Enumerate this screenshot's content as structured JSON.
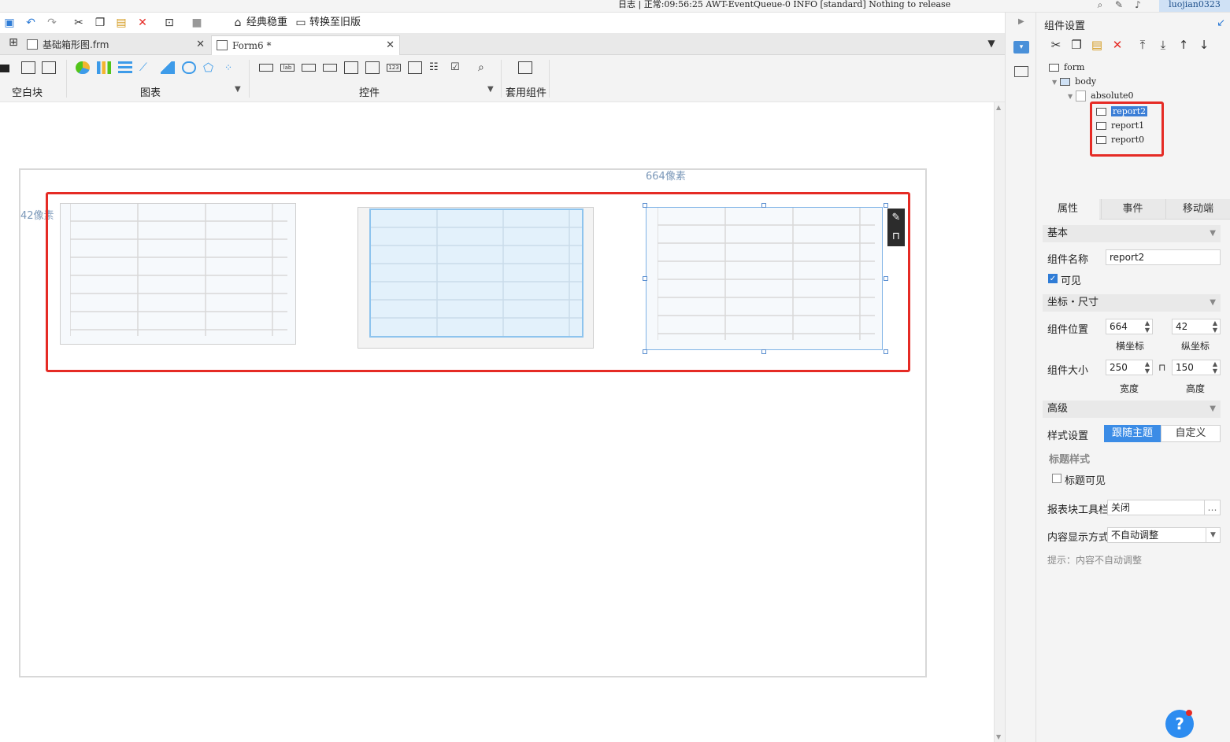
{
  "topbar": {
    "log_label": "日志",
    "log_message": "正常:09:56:25 AWT-EventQueue-0 INFO [standard] Nothing to release",
    "user": "luojian0323"
  },
  "quickbar": {
    "theme_label": "经典稳重",
    "convert_label": "转换至旧版"
  },
  "tabs": [
    {
      "label": "基础箱形图.frm"
    },
    {
      "label": "Form6 *"
    }
  ],
  "ribbon": {
    "groups": {
      "blank": "空白块",
      "chart": "图表",
      "widget": "控件",
      "template": "套用组件"
    }
  },
  "canvas": {
    "hint_x": "664像素",
    "hint_y": "42像素"
  },
  "panel": {
    "title": "组件设置",
    "tree": {
      "form": "form",
      "body": "body",
      "absolute": "absolute0",
      "reports": [
        "report2",
        "report1",
        "report0"
      ]
    },
    "tabs": [
      "属性",
      "事件",
      "移动端"
    ],
    "basic": {
      "section": "基本",
      "name_label": "组件名称",
      "name_value": "report2",
      "visible_label": "可见"
    },
    "geometry": {
      "section": "坐标・尺寸",
      "position_label": "组件位置",
      "x_value": "664",
      "y_value": "42",
      "x_caption": "横坐标",
      "y_caption": "纵坐标",
      "size_label": "组件大小",
      "width_value": "250",
      "height_value": "150",
      "width_caption": "宽度",
      "height_caption": "高度"
    },
    "advanced": {
      "section": "高级",
      "style_label": "样式设置",
      "style_follow": "跟随主题",
      "style_custom": "自定义",
      "title_style": "标题样式",
      "title_visible": "标题可见",
      "toolbar_label": "报表块工具栏",
      "toolbar_value": "关闭",
      "content_label": "内容显示方式",
      "content_value": "不自动调整",
      "hint": "提示：内容不自动调整"
    }
  },
  "help": {
    "symbol": "?"
  }
}
